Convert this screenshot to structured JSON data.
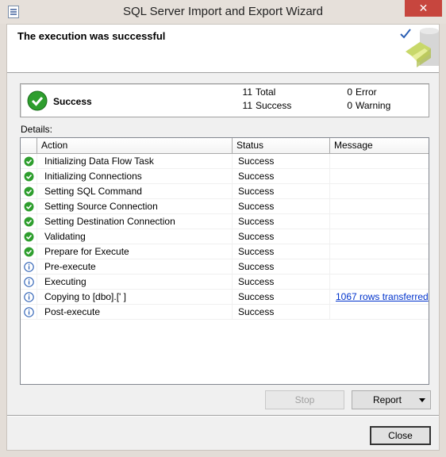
{
  "window": {
    "title": "SQL Server Import and Export Wizard",
    "close_glyph": "✕"
  },
  "header": {
    "title": "The execution was successful"
  },
  "summary": {
    "status_label": "Success",
    "total_count": "11",
    "total_label": "Total",
    "success_count": "11",
    "success_label": "Success",
    "error_count": "0",
    "error_label": "Error",
    "warning_count": "0",
    "warning_label": "Warning"
  },
  "details": {
    "label": "Details:",
    "columns": [
      "Action",
      "Status",
      "Message"
    ],
    "rows": [
      {
        "icon": "success-icon",
        "action": "Initializing Data Flow Task",
        "status": "Success",
        "message": ""
      },
      {
        "icon": "success-icon",
        "action": "Initializing Connections",
        "status": "Success",
        "message": ""
      },
      {
        "icon": "success-icon",
        "action": "Setting SQL Command",
        "status": "Success",
        "message": ""
      },
      {
        "icon": "success-icon",
        "action": "Setting Source Connection",
        "status": "Success",
        "message": ""
      },
      {
        "icon": "success-icon",
        "action": "Setting Destination Connection",
        "status": "Success",
        "message": ""
      },
      {
        "icon": "success-icon",
        "action": "Validating",
        "status": "Success",
        "message": ""
      },
      {
        "icon": "success-icon",
        "action": "Prepare for Execute",
        "status": "Success",
        "message": ""
      },
      {
        "icon": "info-icon",
        "action": "Pre-execute",
        "status": "Success",
        "message": ""
      },
      {
        "icon": "info-icon",
        "action": "Executing",
        "status": "Success",
        "message": ""
      },
      {
        "icon": "info-icon",
        "action": "Copying to [dbo].['                              ]",
        "status": "Success",
        "message": "1067 rows transferred"
      },
      {
        "icon": "info-icon",
        "action": "Post-execute",
        "status": "Success",
        "message": ""
      }
    ]
  },
  "buttons": {
    "stop": "Stop",
    "report": "Report",
    "close": "Close"
  },
  "colors": {
    "success_green": "#2e9e2e",
    "info_blue": "#2b5fb4",
    "link_blue": "#0033cc",
    "close_red": "#c7463e"
  }
}
